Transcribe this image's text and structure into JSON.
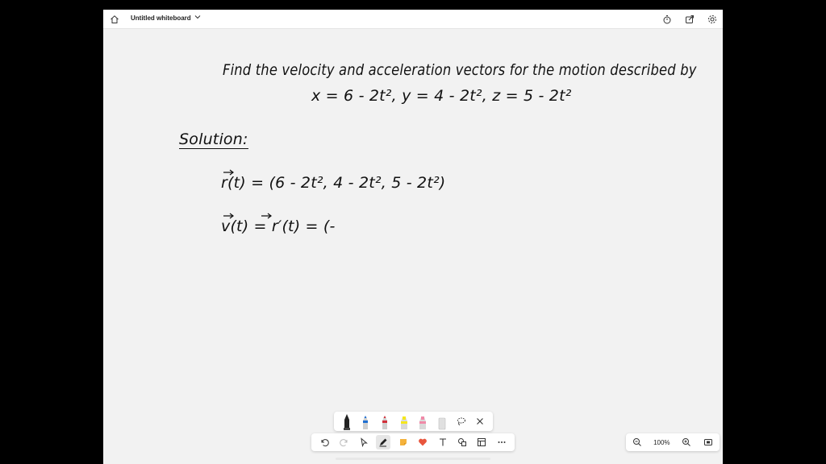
{
  "app": {
    "title": "Untitled whiteboard"
  },
  "whiteboard": {
    "question_line1": "Find the velocity and acceleration vectors for the motion described by",
    "question_line2": "x = 6 - 2t², y = 4 - 2t², z = 5 - 2t²",
    "solution_label": "Solution:",
    "equation1": "r(t) = (6 - 2t², 4 - 2t², 5 - 2t²)",
    "equation2": "v(t) = r′(t) = (-"
  },
  "zoom": {
    "level": "100%"
  },
  "colors": {
    "background": "#f2f2f2",
    "ink": "#111111",
    "pen_black": "#222222",
    "pen_blue": "#1f6fd1",
    "pen_red": "#d1303a",
    "highlighter_yellow": "#f5e71c",
    "highlighter_pink": "#f08aa8",
    "eraser": "#d9d9d9",
    "reaction_heart": "#e8553d",
    "sticky_note": "#f5b23b"
  },
  "icons": {
    "home": "home-icon",
    "dropdown": "chevron-down-icon",
    "timer": "timer-icon",
    "share": "share-icon",
    "settings": "gear-icon",
    "undo": "undo-icon",
    "redo": "redo-icon",
    "select": "pointer-icon",
    "pen": "pen-icon",
    "sticky": "sticky-note-icon",
    "reaction": "heart-icon",
    "text": "text-icon",
    "shapes": "shapes-icon",
    "template": "template-icon",
    "more": "more-icon",
    "lasso": "lasso-icon",
    "close": "close-icon",
    "zoom_out": "zoom-out-icon",
    "zoom_in": "zoom-in-icon",
    "fit": "fit-screen-icon"
  }
}
